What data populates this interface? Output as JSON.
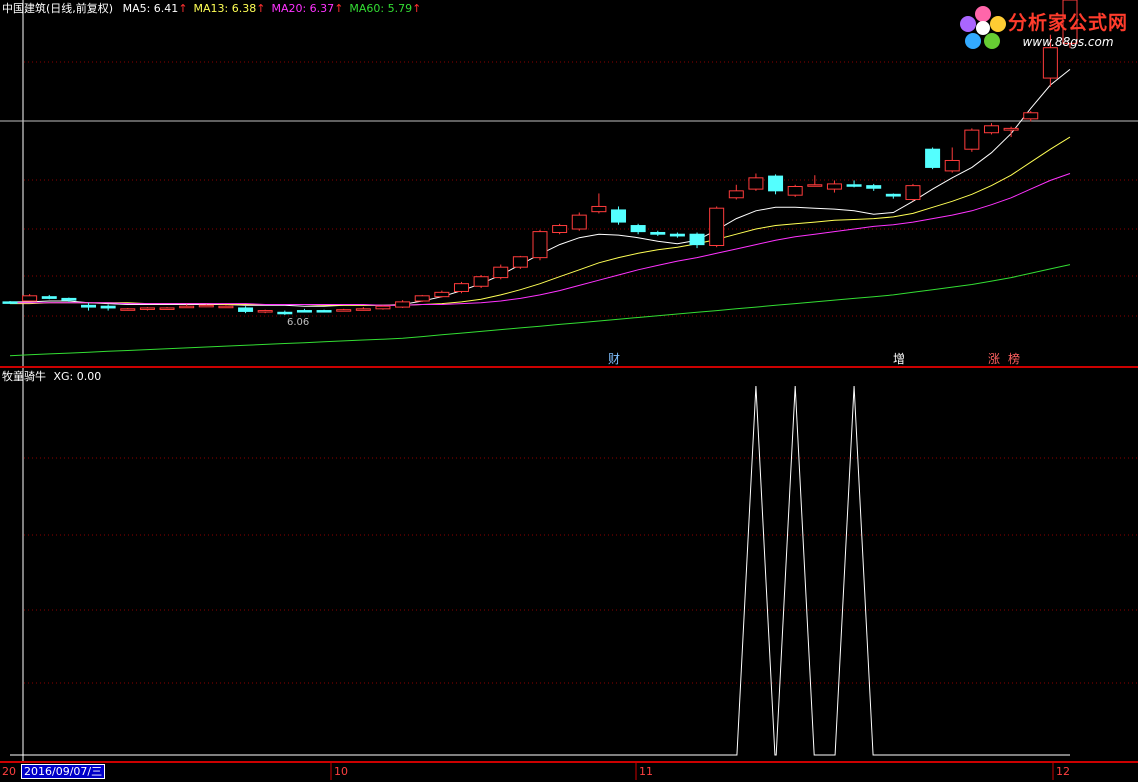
{
  "header": {
    "stock": "中国建筑(日线,前复权)",
    "ma": [
      {
        "label": "MA5: 6.41",
        "color": "#ffffff"
      },
      {
        "label": "MA13: 6.38",
        "color": "#ffff55"
      },
      {
        "label": "MA20: 6.37",
        "color": "#ff33ff"
      },
      {
        "label": "MA60: 5.79",
        "color": "#33dd33"
      }
    ],
    "arrow": "↑"
  },
  "logo": {
    "text": "分析家公式网",
    "url": "www.88gs.com"
  },
  "indicator": {
    "title": "牧童骑牛",
    "value_label": "XG: 0.00"
  },
  "date_box": "2016/09/07/三",
  "date_box_prefix": "20",
  "x_labels": [
    "10",
    "11",
    "12"
  ],
  "markers": [
    "财",
    "增",
    "涨",
    "榜"
  ],
  "min_label": "6.06",
  "colors": {
    "up": "#ff3c3c",
    "down": "#54ffff",
    "background": "#000000",
    "grid": "#8b0000",
    "ma5": "#ffffff",
    "ma13": "#ffff55",
    "ma20": "#ff33ff",
    "ma60": "#33dd33"
  },
  "chart_data": [
    {
      "type": "candlestick",
      "series": [
        {
          "name": "MA5",
          "values": [
            6.12,
            6.12,
            6.13,
            6.13,
            6.11,
            6.1,
            6.09,
            6.09,
            6.09,
            6.09,
            6.09,
            6.09,
            6.08,
            6.08,
            6.08,
            6.07,
            6.07,
            6.08,
            6.08,
            6.08,
            6.09,
            6.13,
            6.18,
            6.25,
            6.33,
            6.43,
            6.55,
            6.67,
            6.78,
            6.86,
            6.9,
            6.89,
            6.86,
            6.82,
            6.79,
            6.83,
            6.95,
            7.08,
            7.17,
            7.21,
            7.21,
            7.2,
            7.19,
            7.17,
            7.13,
            7.15,
            7.28,
            7.42,
            7.55,
            7.67,
            7.84,
            8.06,
            8.35,
            8.62,
            8.8
          ]
        },
        {
          "name": "MA13",
          "values": [
            6.1,
            6.1,
            6.11,
            6.11,
            6.11,
            6.11,
            6.11,
            6.1,
            6.1,
            6.1,
            6.1,
            6.09,
            6.09,
            6.09,
            6.09,
            6.09,
            6.08,
            6.08,
            6.08,
            6.08,
            6.08,
            6.09,
            6.1,
            6.12,
            6.15,
            6.2,
            6.26,
            6.33,
            6.41,
            6.49,
            6.57,
            6.63,
            6.68,
            6.72,
            6.75,
            6.79,
            6.84,
            6.9,
            6.96,
            7.0,
            7.02,
            7.04,
            7.06,
            7.07,
            7.08,
            7.1,
            7.14,
            7.21,
            7.28,
            7.36,
            7.46,
            7.58,
            7.73,
            7.88,
            8.02
          ]
        },
        {
          "name": "MA20",
          "values": [
            6.11,
            6.11,
            6.11,
            6.11,
            6.11,
            6.11,
            6.1,
            6.1,
            6.1,
            6.1,
            6.1,
            6.1,
            6.1,
            6.09,
            6.09,
            6.09,
            6.09,
            6.09,
            6.09,
            6.08,
            6.08,
            6.09,
            6.09,
            6.1,
            6.11,
            6.13,
            6.16,
            6.2,
            6.25,
            6.31,
            6.37,
            6.43,
            6.49,
            6.54,
            6.59,
            6.63,
            6.68,
            6.73,
            6.78,
            6.83,
            6.87,
            6.9,
            6.93,
            6.96,
            6.99,
            7.01,
            7.04,
            7.08,
            7.12,
            7.17,
            7.24,
            7.32,
            7.42,
            7.52,
            7.6
          ]
        },
        {
          "name": "MA60",
          "values": [
            5.5,
            5.51,
            5.52,
            5.53,
            5.54,
            5.55,
            5.56,
            5.57,
            5.58,
            5.59,
            5.6,
            5.61,
            5.62,
            5.63,
            5.64,
            5.65,
            5.66,
            5.67,
            5.68,
            5.69,
            5.7,
            5.72,
            5.74,
            5.76,
            5.78,
            5.8,
            5.82,
            5.84,
            5.86,
            5.88,
            5.9,
            5.92,
            5.94,
            5.96,
            5.98,
            6.0,
            6.02,
            6.04,
            6.06,
            6.08,
            6.1,
            6.12,
            6.14,
            6.16,
            6.18,
            6.2,
            6.23,
            6.26,
            6.29,
            6.32,
            6.36,
            6.4,
            6.45,
            6.5,
            6.55
          ]
        }
      ],
      "candles": [
        {
          "o": 6.12,
          "h": 6.13,
          "l": 6.1,
          "c": 6.11
        },
        {
          "o": 6.13,
          "h": 6.21,
          "l": 6.13,
          "c": 6.19
        },
        {
          "o": 6.18,
          "h": 6.2,
          "l": 6.15,
          "c": 6.16
        },
        {
          "o": 6.16,
          "h": 6.17,
          "l": 6.12,
          "c": 6.14
        },
        {
          "o": 6.08,
          "h": 6.11,
          "l": 6.02,
          "c": 6.06
        },
        {
          "o": 6.07,
          "h": 6.09,
          "l": 6.02,
          "c": 6.05
        },
        {
          "o": 6.03,
          "h": 6.05,
          "l": 6.02,
          "c": 6.04
        },
        {
          "o": 6.04,
          "h": 6.06,
          "l": 6.02,
          "c": 6.05
        },
        {
          "o": 6.05,
          "h": 6.06,
          "l": 6.04,
          "c": 6.05
        },
        {
          "o": 6.07,
          "h": 6.09,
          "l": 6.06,
          "c": 6.07
        },
        {
          "o": 6.07,
          "h": 6.09,
          "l": 6.06,
          "c": 6.08
        },
        {
          "o": 6.06,
          "h": 6.08,
          "l": 6.05,
          "c": 6.07
        },
        {
          "o": 6.05,
          "h": 6.07,
          "l": 5.99,
          "c": 6.01
        },
        {
          "o": 6.01,
          "h": 6.03,
          "l": 5.99,
          "c": 6.02
        },
        {
          "o": 6.0,
          "h": 6.02,
          "l": 5.97,
          "c": 5.99
        },
        {
          "o": 6.02,
          "h": 6.04,
          "l": 6.0,
          "c": 6.01
        },
        {
          "o": 6.02,
          "h": 6.03,
          "l": 6.0,
          "c": 6.01
        },
        {
          "o": 6.02,
          "h": 6.04,
          "l": 6.01,
          "c": 6.03
        },
        {
          "o": 6.03,
          "h": 6.06,
          "l": 6.02,
          "c": 6.04
        },
        {
          "o": 6.04,
          "h": 6.08,
          "l": 6.03,
          "c": 6.07
        },
        {
          "o": 6.06,
          "h": 6.14,
          "l": 6.05,
          "c": 6.12
        },
        {
          "o": 6.13,
          "h": 6.2,
          "l": 6.12,
          "c": 6.19
        },
        {
          "o": 6.18,
          "h": 6.25,
          "l": 6.17,
          "c": 6.23
        },
        {
          "o": 6.24,
          "h": 6.35,
          "l": 6.22,
          "c": 6.33
        },
        {
          "o": 6.3,
          "h": 6.43,
          "l": 6.28,
          "c": 6.41
        },
        {
          "o": 6.4,
          "h": 6.55,
          "l": 6.38,
          "c": 6.52
        },
        {
          "o": 6.52,
          "h": 6.65,
          "l": 6.5,
          "c": 6.64
        },
        {
          "o": 6.63,
          "h": 6.95,
          "l": 6.6,
          "c": 6.93
        },
        {
          "o": 6.92,
          "h": 7.02,
          "l": 6.9,
          "c": 7.0
        },
        {
          "o": 6.96,
          "h": 7.15,
          "l": 6.94,
          "c": 7.12
        },
        {
          "o": 7.16,
          "h": 7.37,
          "l": 7.14,
          "c": 7.22
        },
        {
          "o": 7.18,
          "h": 7.22,
          "l": 7.01,
          "c": 7.04
        },
        {
          "o": 7.0,
          "h": 7.02,
          "l": 6.9,
          "c": 6.93
        },
        {
          "o": 6.92,
          "h": 6.94,
          "l": 6.88,
          "c": 6.9
        },
        {
          "o": 6.9,
          "h": 6.92,
          "l": 6.86,
          "c": 6.88
        },
        {
          "o": 6.9,
          "h": 6.92,
          "l": 6.74,
          "c": 6.78
        },
        {
          "o": 6.77,
          "h": 7.22,
          "l": 6.75,
          "c": 7.2
        },
        {
          "o": 7.32,
          "h": 7.47,
          "l": 7.3,
          "c": 7.4
        },
        {
          "o": 7.42,
          "h": 7.6,
          "l": 7.4,
          "c": 7.55
        },
        {
          "o": 7.57,
          "h": 7.59,
          "l": 7.36,
          "c": 7.4
        },
        {
          "o": 7.35,
          "h": 7.47,
          "l": 7.33,
          "c": 7.45
        },
        {
          "o": 7.47,
          "h": 7.58,
          "l": 7.45,
          "c": 7.47
        },
        {
          "o": 7.42,
          "h": 7.52,
          "l": 7.38,
          "c": 7.48
        },
        {
          "o": 7.47,
          "h": 7.52,
          "l": 7.44,
          "c": 7.46
        },
        {
          "o": 7.46,
          "h": 7.48,
          "l": 7.4,
          "c": 7.43
        },
        {
          "o": 7.36,
          "h": 7.37,
          "l": 7.31,
          "c": 7.34
        },
        {
          "o": 7.3,
          "h": 7.48,
          "l": 7.28,
          "c": 7.46
        },
        {
          "o": 7.88,
          "h": 7.9,
          "l": 7.65,
          "c": 7.67
        },
        {
          "o": 7.63,
          "h": 7.9,
          "l": 7.61,
          "c": 7.75
        },
        {
          "o": 7.88,
          "h": 8.12,
          "l": 7.85,
          "c": 8.1
        },
        {
          "o": 8.07,
          "h": 8.18,
          "l": 8.05,
          "c": 8.15
        },
        {
          "o": 8.1,
          "h": 8.14,
          "l": 8.02,
          "c": 8.12
        },
        {
          "o": 8.23,
          "h": 8.32,
          "l": 8.2,
          "c": 8.3
        },
        {
          "o": 8.7,
          "h": 9.2,
          "l": 8.6,
          "c": 9.05
        },
        {
          "o": 9.1,
          "h": 9.8,
          "l": 9.05,
          "c": 9.6
        }
      ],
      "ylim": [
        5.45,
        9.6
      ]
    },
    {
      "type": "line",
      "series": [
        {
          "name": "XG",
          "values": [
            0,
            0,
            0,
            0,
            0,
            0,
            0,
            0,
            0,
            0,
            0,
            0,
            0,
            0,
            0,
            0,
            0,
            0,
            0,
            0,
            0,
            0,
            0,
            0,
            0,
            0,
            0,
            0,
            0,
            0,
            0,
            0,
            0,
            0,
            0,
            0,
            0,
            0,
            1,
            0,
            1,
            0,
            0,
            1,
            0,
            0,
            0,
            0,
            0,
            0,
            0,
            0,
            0,
            0,
            0
          ]
        }
      ],
      "ylim": [
        0,
        1
      ]
    }
  ]
}
